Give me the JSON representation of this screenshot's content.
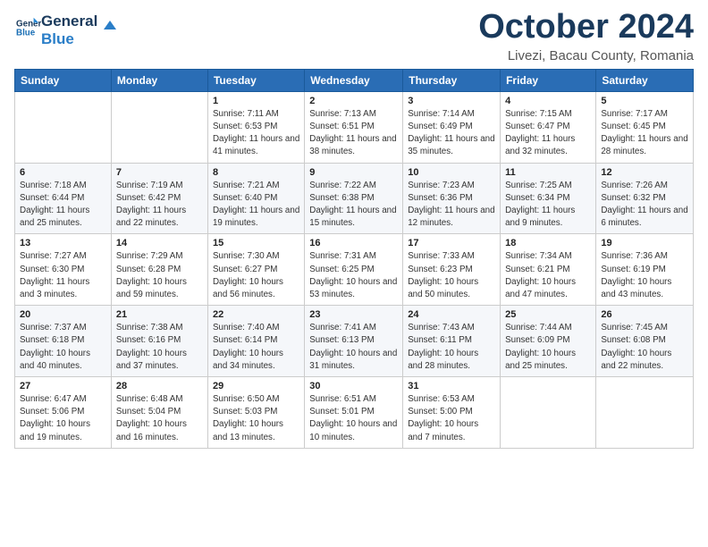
{
  "header": {
    "logo_line1": "General",
    "logo_line2": "Blue",
    "month": "October 2024",
    "location": "Livezi, Bacau County, Romania"
  },
  "days_of_week": [
    "Sunday",
    "Monday",
    "Tuesday",
    "Wednesday",
    "Thursday",
    "Friday",
    "Saturday"
  ],
  "weeks": [
    [
      {
        "day": "",
        "detail": ""
      },
      {
        "day": "",
        "detail": ""
      },
      {
        "day": "1",
        "detail": "Sunrise: 7:11 AM\nSunset: 6:53 PM\nDaylight: 11 hours and 41 minutes."
      },
      {
        "day": "2",
        "detail": "Sunrise: 7:13 AM\nSunset: 6:51 PM\nDaylight: 11 hours and 38 minutes."
      },
      {
        "day": "3",
        "detail": "Sunrise: 7:14 AM\nSunset: 6:49 PM\nDaylight: 11 hours and 35 minutes."
      },
      {
        "day": "4",
        "detail": "Sunrise: 7:15 AM\nSunset: 6:47 PM\nDaylight: 11 hours and 32 minutes."
      },
      {
        "day": "5",
        "detail": "Sunrise: 7:17 AM\nSunset: 6:45 PM\nDaylight: 11 hours and 28 minutes."
      }
    ],
    [
      {
        "day": "6",
        "detail": "Sunrise: 7:18 AM\nSunset: 6:44 PM\nDaylight: 11 hours and 25 minutes."
      },
      {
        "day": "7",
        "detail": "Sunrise: 7:19 AM\nSunset: 6:42 PM\nDaylight: 11 hours and 22 minutes."
      },
      {
        "day": "8",
        "detail": "Sunrise: 7:21 AM\nSunset: 6:40 PM\nDaylight: 11 hours and 19 minutes."
      },
      {
        "day": "9",
        "detail": "Sunrise: 7:22 AM\nSunset: 6:38 PM\nDaylight: 11 hours and 15 minutes."
      },
      {
        "day": "10",
        "detail": "Sunrise: 7:23 AM\nSunset: 6:36 PM\nDaylight: 11 hours and 12 minutes."
      },
      {
        "day": "11",
        "detail": "Sunrise: 7:25 AM\nSunset: 6:34 PM\nDaylight: 11 hours and 9 minutes."
      },
      {
        "day": "12",
        "detail": "Sunrise: 7:26 AM\nSunset: 6:32 PM\nDaylight: 11 hours and 6 minutes."
      }
    ],
    [
      {
        "day": "13",
        "detail": "Sunrise: 7:27 AM\nSunset: 6:30 PM\nDaylight: 11 hours and 3 minutes."
      },
      {
        "day": "14",
        "detail": "Sunrise: 7:29 AM\nSunset: 6:28 PM\nDaylight: 10 hours and 59 minutes."
      },
      {
        "day": "15",
        "detail": "Sunrise: 7:30 AM\nSunset: 6:27 PM\nDaylight: 10 hours and 56 minutes."
      },
      {
        "day": "16",
        "detail": "Sunrise: 7:31 AM\nSunset: 6:25 PM\nDaylight: 10 hours and 53 minutes."
      },
      {
        "day": "17",
        "detail": "Sunrise: 7:33 AM\nSunset: 6:23 PM\nDaylight: 10 hours and 50 minutes."
      },
      {
        "day": "18",
        "detail": "Sunrise: 7:34 AM\nSunset: 6:21 PM\nDaylight: 10 hours and 47 minutes."
      },
      {
        "day": "19",
        "detail": "Sunrise: 7:36 AM\nSunset: 6:19 PM\nDaylight: 10 hours and 43 minutes."
      }
    ],
    [
      {
        "day": "20",
        "detail": "Sunrise: 7:37 AM\nSunset: 6:18 PM\nDaylight: 10 hours and 40 minutes."
      },
      {
        "day": "21",
        "detail": "Sunrise: 7:38 AM\nSunset: 6:16 PM\nDaylight: 10 hours and 37 minutes."
      },
      {
        "day": "22",
        "detail": "Sunrise: 7:40 AM\nSunset: 6:14 PM\nDaylight: 10 hours and 34 minutes."
      },
      {
        "day": "23",
        "detail": "Sunrise: 7:41 AM\nSunset: 6:13 PM\nDaylight: 10 hours and 31 minutes."
      },
      {
        "day": "24",
        "detail": "Sunrise: 7:43 AM\nSunset: 6:11 PM\nDaylight: 10 hours and 28 minutes."
      },
      {
        "day": "25",
        "detail": "Sunrise: 7:44 AM\nSunset: 6:09 PM\nDaylight: 10 hours and 25 minutes."
      },
      {
        "day": "26",
        "detail": "Sunrise: 7:45 AM\nSunset: 6:08 PM\nDaylight: 10 hours and 22 minutes."
      }
    ],
    [
      {
        "day": "27",
        "detail": "Sunrise: 6:47 AM\nSunset: 5:06 PM\nDaylight: 10 hours and 19 minutes."
      },
      {
        "day": "28",
        "detail": "Sunrise: 6:48 AM\nSunset: 5:04 PM\nDaylight: 10 hours and 16 minutes."
      },
      {
        "day": "29",
        "detail": "Sunrise: 6:50 AM\nSunset: 5:03 PM\nDaylight: 10 hours and 13 minutes."
      },
      {
        "day": "30",
        "detail": "Sunrise: 6:51 AM\nSunset: 5:01 PM\nDaylight: 10 hours and 10 minutes."
      },
      {
        "day": "31",
        "detail": "Sunrise: 6:53 AM\nSunset: 5:00 PM\nDaylight: 10 hours and 7 minutes."
      },
      {
        "day": "",
        "detail": ""
      },
      {
        "day": "",
        "detail": ""
      }
    ]
  ]
}
